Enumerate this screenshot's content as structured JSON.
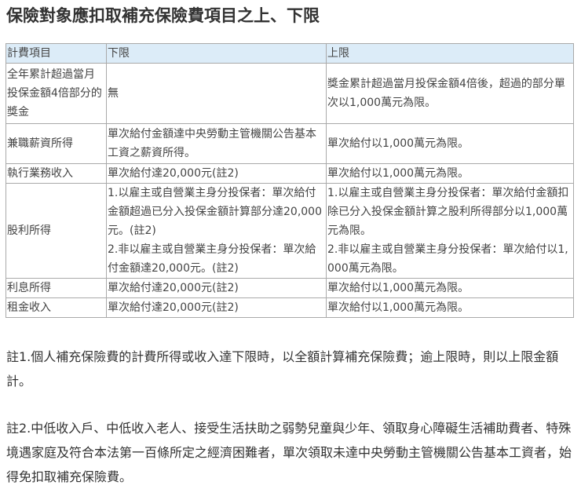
{
  "title": "保險對象應扣取補充保險費項目之上、下限",
  "table": {
    "headers": [
      "計費項目",
      "下限",
      "上限"
    ],
    "rows": [
      {
        "item": "全年累計超過當月投保金額4倍部分的獎金",
        "lower": "無",
        "upper": "獎金累計超過當月投保金額4倍後，超過的部分單次以1,000萬元為限。"
      },
      {
        "item": "兼職薪資所得",
        "lower": "單次給付金額達中央勞動主管機關公告基本工資之薪資所得。",
        "upper": "單次給付以1,000萬元為限。"
      },
      {
        "item": "執行業務收入",
        "lower": "單次給付達20,000元(註2)",
        "upper": "單次給付以1,000萬元為限。"
      },
      {
        "item": "股利所得",
        "lower1": "1.以雇主或自營業主身分投保者：單次給付金額超過已分入投保金額計算部分達20,000元。(註2)",
        "lower2": "2.非以雇主或自營業主身分投保者：單次給付金額達20,000元。(註2)",
        "upper1": "1.以雇主或自營業主身分投保者：單次給付金額扣除已分入投保金額計算之股利所得部分以1,000萬元為限。",
        "upper2": "2.非以雇主或自營業主身分投保者：單次給付以1,000萬元為限。"
      },
      {
        "item": "利息所得",
        "lower": "單次給付達20,000元(註2)",
        "upper": "單次給付以1,000萬元為限。"
      },
      {
        "item": "租金收入",
        "lower": "單次給付達20,000元(註2)",
        "upper": "單次給付以1,000萬元為限。"
      }
    ]
  },
  "notes": [
    "註1.個人補充保險費的計費所得或收入達下限時，以全額計算補充保險費；逾上限時，則以上限金額計。",
    "註2.中低收入戶、中低收入老人、接受生活扶助之弱勢兒童與少年、領取身心障礙生活補助費者、特殊境遇家庭及符合本法第一百條所定之經濟困難者，單次領取未達中央勞動主管機關公告基本工資者，始得免扣取補充保險費。"
  ]
}
